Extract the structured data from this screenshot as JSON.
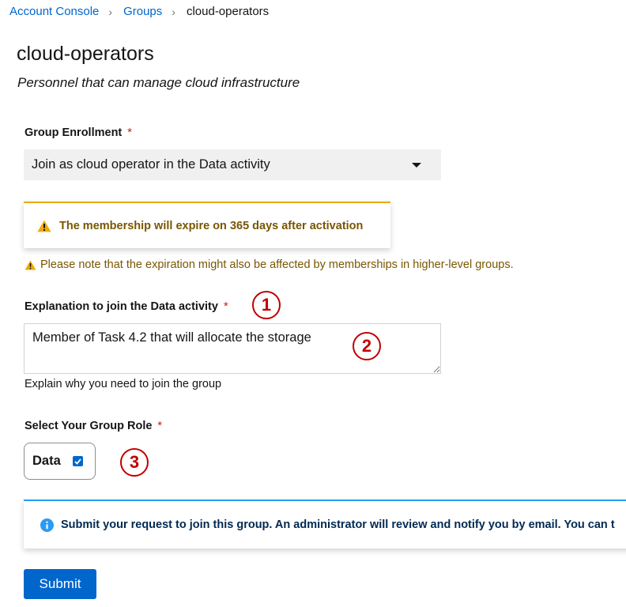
{
  "breadcrumb": {
    "items": [
      "Account Console",
      "Groups"
    ],
    "current": "cloud-operators"
  },
  "page": {
    "title": "cloud-operators",
    "description": "Personnel that can manage cloud infrastructure"
  },
  "enrollment": {
    "label": "Group Enrollment",
    "required_marker": "*",
    "selected": "Join as cloud operator in the Data activity"
  },
  "warning_alert": {
    "text": "The membership will expire on 365 days after activation"
  },
  "note": {
    "text": "Please note that the expiration might also be affected by memberships in higher-level groups."
  },
  "explanation": {
    "label": "Explanation to join the Data activity",
    "required_marker": "*",
    "value": "Member of Task 4.2 that will allocate the storage",
    "helper": "Explain why you need to join the group"
  },
  "role": {
    "label": "Select Your Group Role",
    "required_marker": "*",
    "option_label": "Data",
    "checked": true
  },
  "info_alert": {
    "text": "Submit your request to join this group. An administrator will review and notify you by email. You can t"
  },
  "submit_label": "Submit",
  "annotations": [
    "1",
    "2",
    "3"
  ],
  "colors": {
    "link": "#0066cc",
    "warning": "#f0ab00",
    "warning_text": "#795600",
    "info": "#2b9af3",
    "info_text": "#002952",
    "required": "#c9190b",
    "annotation": "#c00000",
    "primary_button": "#0066cc"
  },
  "icons": {
    "breadcrumb_separator": "chevron-right-icon",
    "select_toggle": "caret-down-icon",
    "warning": "warning-triangle-icon",
    "info": "info-circle-icon",
    "checkbox": "check-icon"
  }
}
